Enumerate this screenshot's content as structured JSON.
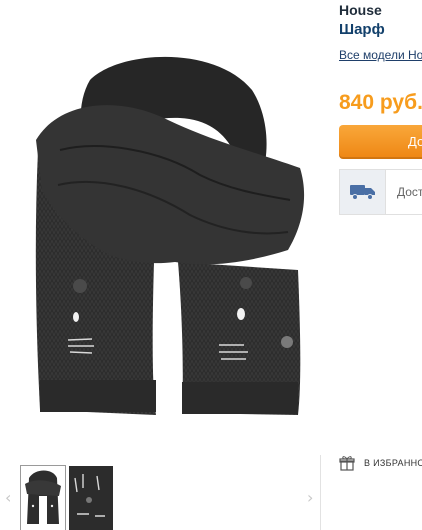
{
  "product": {
    "brand": "House",
    "name": "Шарф",
    "all_models_link": "Все модели House",
    "price": "840 руб.",
    "buy_button_label": "Добавить в корзину",
    "delivery_text": "Доставка",
    "favorites_label": "В ИЗБРАННОЕ"
  },
  "gallery": {
    "prev_arrow": "‹",
    "next_arrow": "›",
    "thumbnails": [
      "scarf-front",
      "scarf-detail"
    ],
    "active_thumbnail": 1
  },
  "icons": {
    "delivery": "truck-icon",
    "favorites": "gift-icon"
  },
  "colors": {
    "price": "#f79c1d",
    "button": "#f0891a",
    "link": "#1f3f6a",
    "scarf": "#2e2e2e"
  }
}
